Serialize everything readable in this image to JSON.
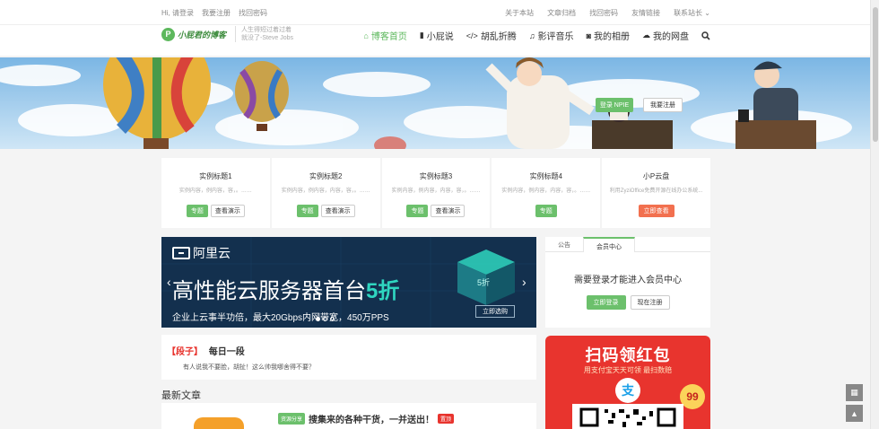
{
  "topbar": {
    "left": [
      "Hi, 请登录",
      "我要注册",
      "找回密码"
    ],
    "right": [
      "关于本站",
      "文章归档",
      "找回密码",
      "友情链接",
      "联系站长 ⌄"
    ]
  },
  "header": {
    "logo_mark": "P",
    "logo_text": "小屁君的博客",
    "slogan_1": "人生得短过着过着",
    "slogan_2": "就没了-Steve Jobs",
    "nav": [
      {
        "label": "博客首页",
        "icon": "home-icon",
        "glyph": "⌂"
      },
      {
        "label": "小屁说",
        "icon": "book-icon",
        "glyph": "▮"
      },
      {
        "label": "胡乱折腾",
        "icon": "code-icon",
        "glyph": "</>"
      },
      {
        "label": "影评音乐",
        "icon": "music-icon",
        "glyph": "♫"
      },
      {
        "label": "我的相册",
        "icon": "camera-icon",
        "glyph": "◙"
      },
      {
        "label": "我的网盘",
        "icon": "cloud-icon",
        "glyph": "☁"
      }
    ]
  },
  "banner": {
    "login_button": "登录 NPIE",
    "register_button": "我要注册"
  },
  "cards": [
    {
      "title": "实例标题1",
      "desc": "实例内容，例内容，容，。……",
      "btn1": "专题",
      "btn2": "查看演示"
    },
    {
      "title": "实例标题2",
      "desc": "实例内容，例内容，内容，容，。……",
      "btn1": "专题",
      "btn2": "查看演示"
    },
    {
      "title": "实例标题3",
      "desc": "实例内容，例内容，内容，容，。……",
      "btn1": "专题",
      "btn2": "查看演示"
    },
    {
      "title": "实例标题4",
      "desc": "实例内容，例内容，内容，容，。……",
      "btn1": "专题"
    },
    {
      "title": "小P云盘",
      "desc": "利用ZyziOffice免费开源在线办公系统...",
      "btn_orange": "立即查看"
    }
  ],
  "ad": {
    "brand": "阿里云",
    "headline": "高性能云服务器首台",
    "highlight": "5折",
    "subline": "企业上云事半功倍，最大20Gbps内网带宽，450万PPS",
    "cta": "立即选购",
    "badge": "5折"
  },
  "sidebar": {
    "tabs": [
      "公告",
      "会员中心"
    ],
    "login_prompt": "需要登录才能进入会员中心",
    "login_button": "立即登录",
    "register_button": "现在注册"
  },
  "joke": {
    "tag": "【段子】",
    "title": "每日一段",
    "text": "有人说我不要脸，胡扯！这么帅我哪舍得不要？"
  },
  "latest": {
    "heading": "最新文章",
    "category": "资源分享",
    "title": "搜集来的各种干货，一并送出！",
    "badge": "置顶"
  },
  "redpack": {
    "title": "扫码领红包",
    "subtitle": "用支付宝天天可领 最扫数赔",
    "amount": "99",
    "alipay_glyph": "支"
  },
  "float": [
    "▦",
    "▲"
  ]
}
